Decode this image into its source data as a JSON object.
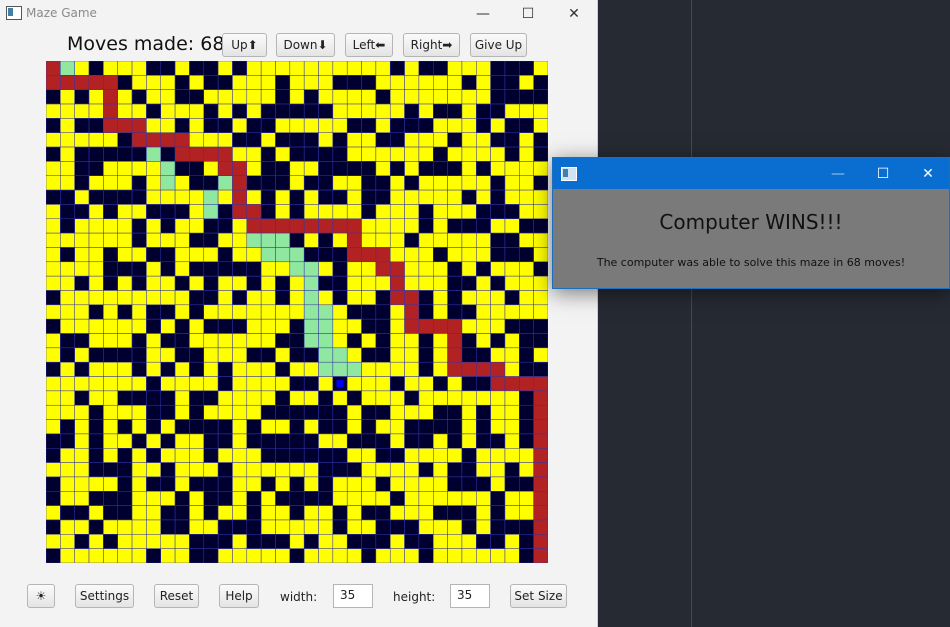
{
  "main_window": {
    "title": "Maze Game",
    "controls": {
      "minimize": "—",
      "maximize": "☐",
      "close": "✕"
    }
  },
  "toolbar": {
    "moves_label": "Moves made: 68",
    "up": "Up⬆",
    "down": "Down⬇",
    "left": "Left⬅",
    "right": "Right➡",
    "give_up": "Give Up"
  },
  "maze": {
    "cols": 35,
    "rows": 35,
    "colors": {
      "open": "#ffff00",
      "wall": "#000030",
      "computer_path": "#b22222",
      "player_path": "#90e8a0",
      "player": "#0000ff",
      "grid": "#3333aa"
    },
    "computer_path_cells": [
      [
        0,
        0
      ],
      [
        0,
        1
      ],
      [
        1,
        1
      ],
      [
        2,
        1
      ],
      [
        3,
        1
      ],
      [
        4,
        1
      ],
      [
        4,
        2
      ],
      [
        4,
        3
      ],
      [
        4,
        4
      ],
      [
        5,
        4
      ],
      [
        6,
        4
      ],
      [
        6,
        5
      ],
      [
        7,
        5
      ],
      [
        8,
        5
      ],
      [
        9,
        5
      ],
      [
        9,
        6
      ],
      [
        10,
        6
      ],
      [
        11,
        6
      ],
      [
        12,
        6
      ],
      [
        12,
        7
      ],
      [
        13,
        7
      ],
      [
        13,
        8
      ],
      [
        13,
        9
      ],
      [
        13,
        10
      ],
      [
        14,
        10
      ],
      [
        14,
        11
      ],
      [
        15,
        11
      ],
      [
        16,
        11
      ],
      [
        17,
        11
      ],
      [
        18,
        11
      ],
      [
        19,
        11
      ],
      [
        20,
        11
      ],
      [
        21,
        11
      ],
      [
        21,
        12
      ],
      [
        21,
        13
      ],
      [
        22,
        13
      ],
      [
        23,
        13
      ],
      [
        23,
        14
      ],
      [
        24,
        14
      ],
      [
        24,
        15
      ],
      [
        24,
        16
      ],
      [
        25,
        16
      ],
      [
        25,
        17
      ],
      [
        25,
        18
      ],
      [
        26,
        18
      ],
      [
        27,
        18
      ],
      [
        28,
        18
      ],
      [
        28,
        19
      ],
      [
        28,
        20
      ],
      [
        28,
        21
      ],
      [
        29,
        21
      ],
      [
        30,
        21
      ],
      [
        31,
        21
      ],
      [
        31,
        22
      ],
      [
        32,
        22
      ],
      [
        33,
        22
      ],
      [
        34,
        22
      ],
      [
        34,
        23
      ],
      [
        34,
        24
      ],
      [
        34,
        25
      ],
      [
        34,
        26
      ],
      [
        34,
        27
      ],
      [
        34,
        28
      ],
      [
        34,
        29
      ],
      [
        34,
        30
      ],
      [
        34,
        31
      ],
      [
        34,
        32
      ],
      [
        34,
        33
      ],
      [
        34,
        34
      ]
    ],
    "player_path_cells": [
      [
        1,
        0
      ],
      [
        7,
        6
      ],
      [
        8,
        7
      ],
      [
        8,
        8
      ],
      [
        11,
        9
      ],
      [
        11,
        10
      ],
      [
        12,
        8
      ],
      [
        14,
        11
      ],
      [
        14,
        12
      ],
      [
        15,
        12
      ],
      [
        16,
        12
      ],
      [
        15,
        13
      ],
      [
        16,
        13
      ],
      [
        17,
        13
      ],
      [
        17,
        14
      ],
      [
        18,
        14
      ],
      [
        18,
        15
      ],
      [
        18,
        16
      ],
      [
        18,
        17
      ],
      [
        18,
        18
      ],
      [
        18,
        19
      ],
      [
        19,
        17
      ],
      [
        19,
        18
      ],
      [
        19,
        19
      ],
      [
        19,
        20
      ],
      [
        19,
        21
      ],
      [
        20,
        21
      ],
      [
        21,
        21
      ],
      [
        20,
        20
      ]
    ],
    "player_cell": [
      20,
      22
    ]
  },
  "footer": {
    "theme_icon": "☀",
    "settings": "Settings",
    "reset": "Reset",
    "help": "Help",
    "width_label": "width:",
    "width_value": "35",
    "height_label": "height:",
    "height_value": "35",
    "set_size": "Set Size"
  },
  "dialog": {
    "heading": "Computer WINS!!!",
    "message": "The computer was able to solve this maze in 68 moves!",
    "controls": {
      "minimize": "—",
      "maximize": "☐",
      "close": "✕"
    }
  }
}
